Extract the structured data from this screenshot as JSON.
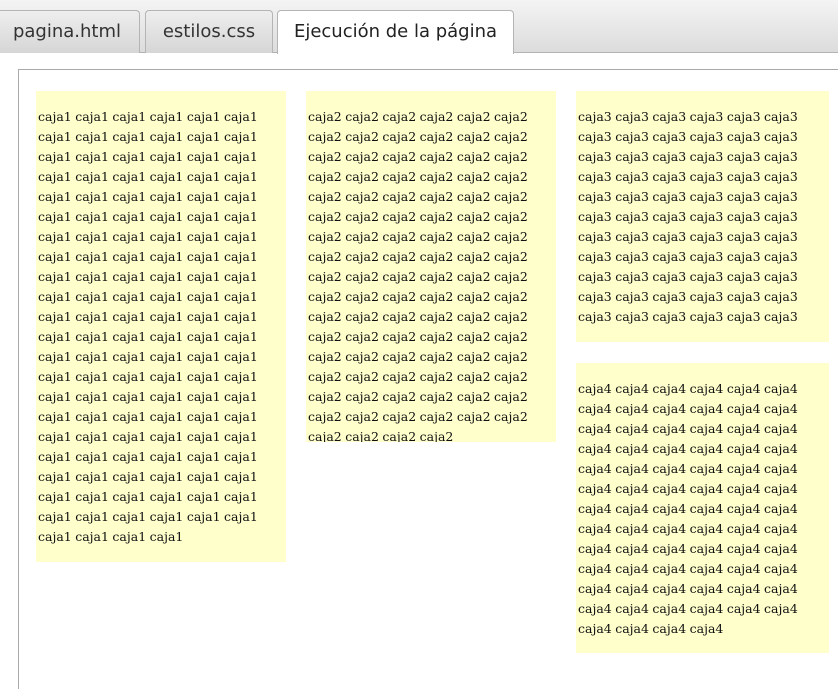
{
  "tabs": [
    {
      "label": "pagina.html",
      "active": false
    },
    {
      "label": "estilos.css",
      "active": false
    },
    {
      "label": "Ejecución de la página",
      "active": true
    }
  ],
  "boxes": [
    {
      "word": "caja1",
      "count": 130
    },
    {
      "word": "caja2",
      "count": 100
    },
    {
      "word": "caja3",
      "count": 66
    },
    {
      "word": "caja4",
      "count": 76
    }
  ],
  "colors": {
    "box_background": "#ffffcc",
    "frame_border": "#a9a9a9",
    "tab_border": "#b4b4b4"
  }
}
